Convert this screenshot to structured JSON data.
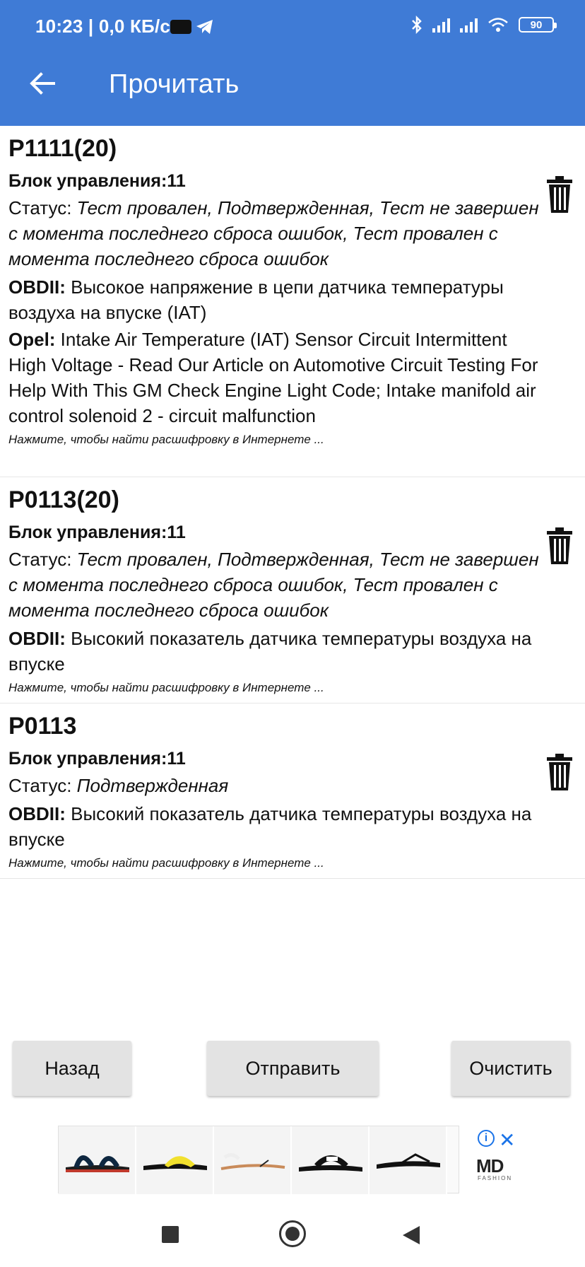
{
  "status_bar": {
    "time_speed": "10:23 | 0,0 КБ/с",
    "battery": "90"
  },
  "toolbar": {
    "title": "Прочитать"
  },
  "codes": [
    {
      "code": "P1111(20)",
      "ecu": "Блок управления:11",
      "status_label": "Статус: ",
      "status_value": "Тест провален, Подтвержденная, Тест не завершен с момента последнего сброса ошибок, Тест провален с момента последнего сброса ошибок",
      "obd_label": "OBDII:",
      "obd_text": " Высокое напряжение в цепи датчика температуры воздуха на впуске (IAT)",
      "opel_label": "Opel:",
      "opel_text": " Intake Air Temperature (IAT) Sensor Circuit Intermittent High Voltage - Read Our Article on Automotive Circuit Testing For Help With This GM Check Engine Light Code; Intake manifold air control solenoid 2 - circuit malfunction",
      "hint": "Нажмите, чтобы найти расшифровку в Интернете ..."
    },
    {
      "code": "P0113(20)",
      "ecu": "Блок управления:11",
      "status_label": "Статус: ",
      "status_value": "Тест провален, Подтвержденная, Тест не завершен с момента последнего сброса ошибок, Тест провален с момента последнего сброса ошибок",
      "obd_label": "OBDII:",
      "obd_text": " Высокий показатель датчика температуры воздуха на впуске",
      "hint": "Нажмите, чтобы найти расшифровку в Интернете ..."
    },
    {
      "code": "P0113",
      "ecu": "Блок управления:11",
      "status_label": "Статус: ",
      "status_value": "Подтвержденная",
      "obd_label": "OBDII:",
      "obd_text": " Высокий показатель датчика температуры воздуха на впуске",
      "hint": "Нажмите, чтобы найти расшифровку в Интернете ..."
    }
  ],
  "buttons": {
    "back": "Назад",
    "send": "Отправить",
    "clear": "Очистить"
  },
  "ad": {
    "logo": "MD",
    "logo_sub": "FASHION"
  },
  "colors": {
    "appbar": "#3f7bd6",
    "button_bg": "#e3e3e3",
    "ad_accent": "#1a73e8"
  },
  "icons": [
    "arrow-back-icon",
    "trash-icon",
    "info-icon",
    "close-icon",
    "bluetooth-icon",
    "signal-icon",
    "wifi-icon",
    "battery-icon",
    "telegram-icon"
  ]
}
